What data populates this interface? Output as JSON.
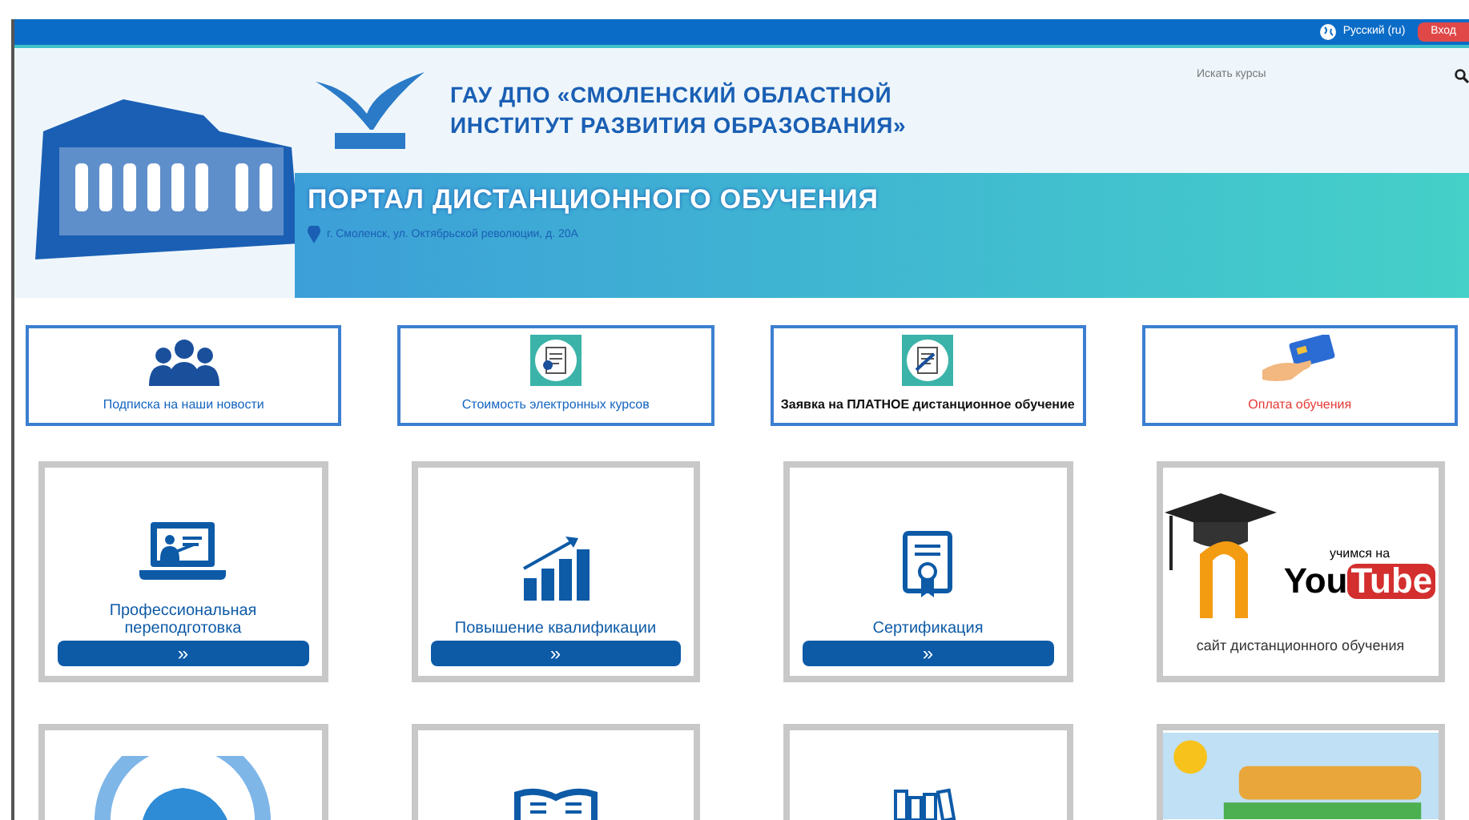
{
  "top_bar": {
    "language": "Русский (ru)",
    "login": "Вход"
  },
  "header": {
    "org_line_1": "ГАУ ДПО «СМОЛЕНСКИЙ ОБЛАСТНОЙ",
    "org_line_2": "ИНСТИТУТ РАЗВИТИЯ ОБРАЗОВАНИЯ»",
    "portal_title": "ПОРТАЛ ДИСТАНЦИОННОГО ОБУЧЕНИЯ",
    "address": "г. Смоленск, ул. Октябрьской революции, д. 20А",
    "search": {
      "placeholder": "Искать курсы"
    }
  },
  "quick_links": [
    {
      "kind": "people",
      "label": "Подписка на наши новости",
      "color": "#1565c0"
    },
    {
      "kind": "document",
      "label": "Стоимость электронных курсов",
      "color": "#1565c0"
    },
    {
      "kind": "form",
      "label": "Заявка на ПЛАТНОЕ дистанционное обучение",
      "color": "#111111"
    },
    {
      "kind": "card",
      "label": "Оплата обучения",
      "color": "#e53935"
    }
  ],
  "tiles": [
    {
      "kind": "laptop",
      "label": "Профессиональная переподготовка",
      "more": "»"
    },
    {
      "kind": "chart",
      "label": "Повышение квалификации",
      "more": "»"
    },
    {
      "kind": "certificate",
      "label": "Сертификация",
      "more": "»"
    },
    {
      "kind": "youtube",
      "caption": "учимся на",
      "logo_a": "You",
      "logo_b": "Tube",
      "label": "сайт дистанционного обучения"
    }
  ],
  "bottom_tiles": [
    {
      "kind": "emblem"
    },
    {
      "kind": "book"
    },
    {
      "kind": "books"
    },
    {
      "kind": "banner"
    }
  ]
}
